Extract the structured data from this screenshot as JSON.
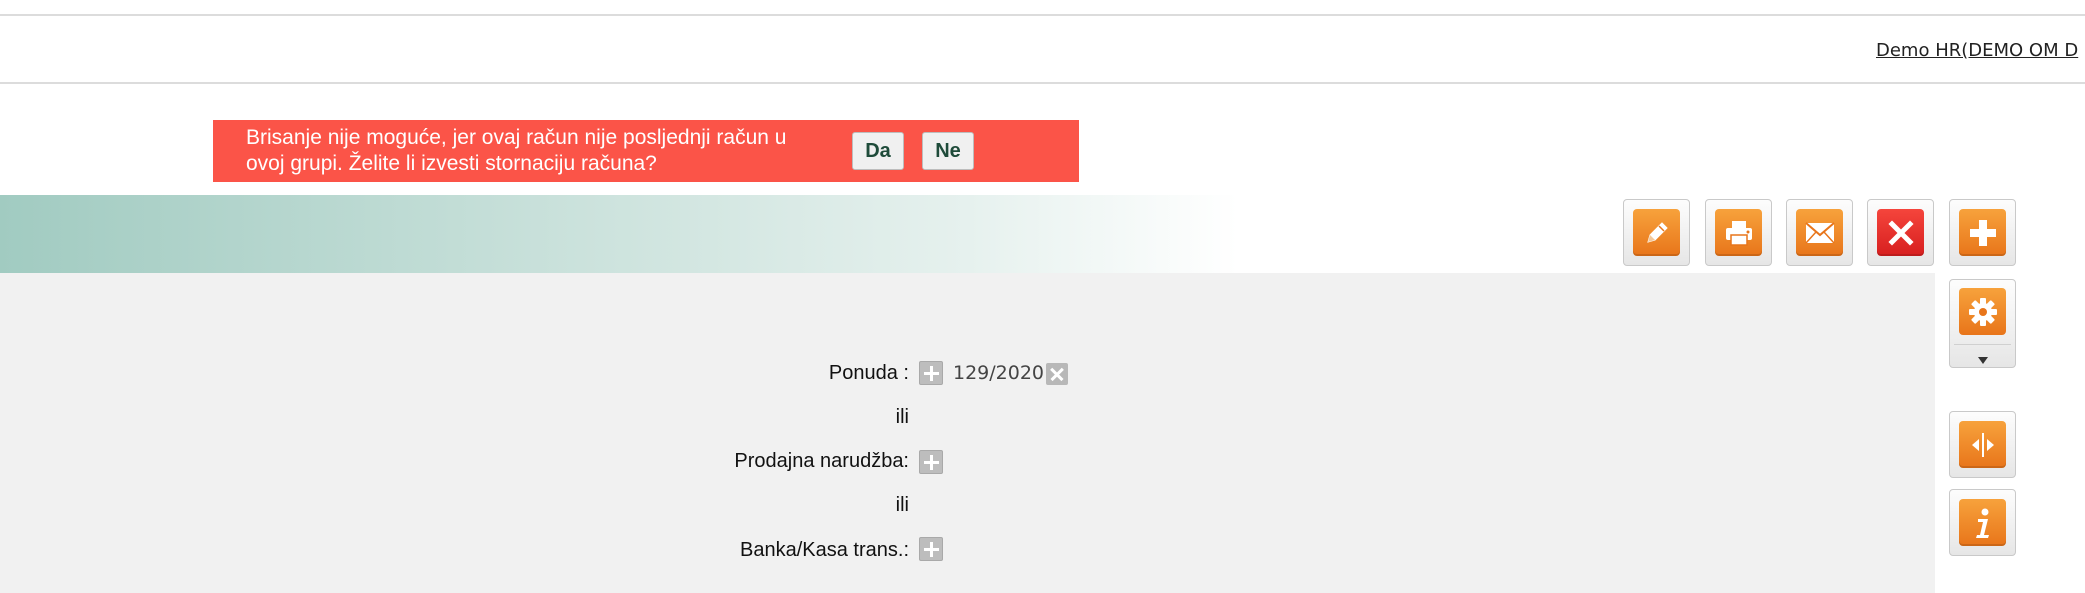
{
  "header": {
    "user_link": "Demo HR(DEMO OM D"
  },
  "alert": {
    "message": "Brisanje nije moguće, jer ovaj račun nije posljednji račun u ovoj grupi. Želite li izvesti stornaciju računa?",
    "yes_label": "Da",
    "no_label": "Ne",
    "color": "#fb5448"
  },
  "toolbar": {
    "buttons": [
      {
        "name": "edit",
        "icon": "pencil-icon"
      },
      {
        "name": "print",
        "icon": "printer-icon"
      },
      {
        "name": "email",
        "icon": "envelope-icon"
      },
      {
        "name": "delete",
        "icon": "close-icon"
      },
      {
        "name": "add",
        "icon": "plus-icon"
      }
    ],
    "side_buttons": [
      {
        "name": "settings",
        "icon": "gear-icon",
        "has_dropdown": true
      },
      {
        "name": "split",
        "icon": "split-arrows-icon"
      },
      {
        "name": "info",
        "icon": "info-icon"
      }
    ],
    "accent_color": "#e8751a"
  },
  "form": {
    "ponuda_label": "Ponuda :",
    "ponuda_value": "129/2020",
    "or_1": "ili",
    "narudzba_label": "Prodajna narudžba:",
    "or_2": "ili",
    "banka_label": "Banka/Kasa trans.:"
  }
}
